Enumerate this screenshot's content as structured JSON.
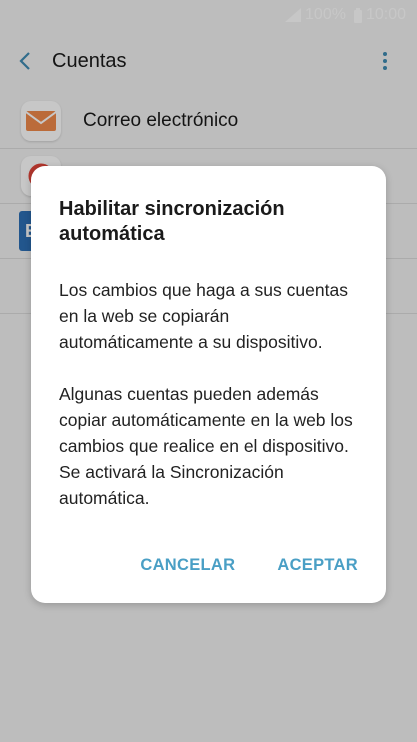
{
  "status_bar": {
    "battery_percent": "100%",
    "time": "10:00",
    "signal_icon": "signal-icon",
    "battery_icon": "battery-icon"
  },
  "app_bar": {
    "title": "Cuentas",
    "back_icon": "back-arrow-icon",
    "more_icon": "more-vertical-icon"
  },
  "accounts": [
    {
      "label": "Correo electrónico",
      "icon": "email-icon"
    },
    {
      "label": "",
      "icon": "google-icon"
    },
    {
      "label": "",
      "icon": "exchange-icon"
    }
  ],
  "dialog": {
    "title": "Habilitar sincronización automática",
    "paragraphs": [
      "Los cambios que haga a sus cuentas en la web se copiarán automáticamente a su dispositivo.",
      "Algunas cuentas pueden además copiar automáticamente en la web los cambios que realice en el dispositivo. Se activará la Sincronización automática."
    ],
    "cancel_label": "CANCELAR",
    "accept_label": "ACEPTAR"
  },
  "colors": {
    "accent": "#4a9fc5",
    "background": "#f2f2f2"
  }
}
